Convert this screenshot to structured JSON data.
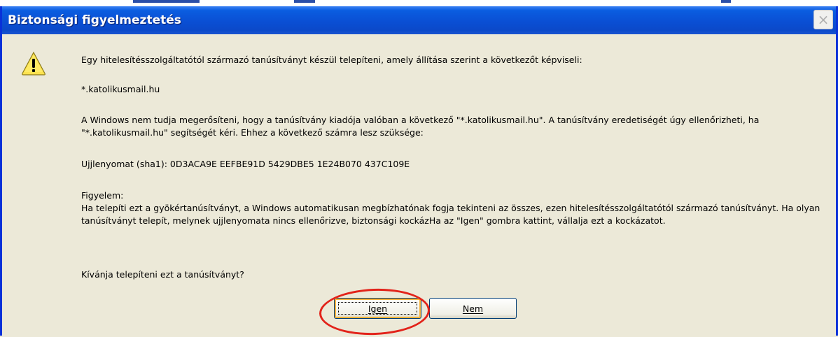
{
  "dialog": {
    "title": "Biztonsági figyelmeztetés",
    "close_glyph": "×",
    "icon": "warning-icon",
    "intro": "Egy hitelesítésszolgáltatótól származó tanúsítványt készül telepíteni, amely állítása szerint a következőt képviseli:",
    "domain": "*.katolikusmail.hu",
    "verify_text": "A Windows nem tudja megerősíteni, hogy a tanúsítvány kiadója valóban a következő \"*.katolikusmail.hu\". A tanúsítvány eredetiségét úgy ellenőrizheti, ha \"*.katolikusmail.hu\" segítségét kéri. Ehhez a következő számra lesz szüksége:",
    "thumbprint": "Ujjlenyomat (sha1): 0D3ACA9E EEFBE91D 5429DBE5 1E24B070 437C109E",
    "warning_heading": "Figyelem:",
    "warning_text": "Ha telepíti ezt a gyökértanúsítványt, a Windows automatikusan megbízhatónak fogja tekinteni az összes, ezen hitelesítésszolgáltatótól származó tanúsítványt. Ha olyan tanúsítványt telepít, melynek ujjlenyomata nincs ellenőrizve, biztonsági kockázHa az \"Igen\" gombra kattint, vállalja ezt a kockázatot.",
    "question": "Kívánja telepíteni ezt a tanúsítványt?",
    "buttons": {
      "yes": "Igen",
      "no": "Nem"
    }
  },
  "colors": {
    "titlebar": "#0a4fd4",
    "dialog_bg": "#ece9d8",
    "annotation": "#e2231a"
  }
}
